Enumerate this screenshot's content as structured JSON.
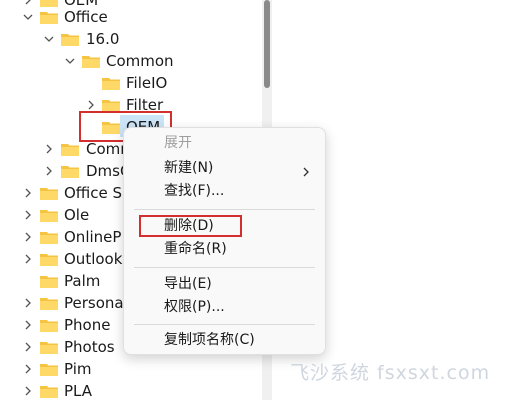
{
  "tree": {
    "items": [
      {
        "label": "OEM",
        "expanded": false
      },
      {
        "label": "Office",
        "expanded": true
      },
      {
        "label": "16.0",
        "expanded": true
      },
      {
        "label": "Common",
        "expanded": true
      },
      {
        "label": "FileIO",
        "expanded": false
      },
      {
        "label": "Filter",
        "expanded": false
      },
      {
        "label": "OEM",
        "expanded": false,
        "selected": true
      },
      {
        "label": "Comm",
        "expanded": false
      },
      {
        "label": "DmsC",
        "expanded": false
      },
      {
        "label": "Office S",
        "expanded": false
      },
      {
        "label": "Ole",
        "expanded": false
      },
      {
        "label": "OnlineP",
        "expanded": false
      },
      {
        "label": "Outlook",
        "expanded": false
      },
      {
        "label": "Palm",
        "expanded": false
      },
      {
        "label": "Persona",
        "expanded": false
      },
      {
        "label": "Phone",
        "expanded": false
      },
      {
        "label": "Photos",
        "expanded": false
      },
      {
        "label": "Pim",
        "expanded": false
      },
      {
        "label": "PLA",
        "expanded": false
      }
    ]
  },
  "context_menu": {
    "header": "展开",
    "new": "新建(N)",
    "find": "查找(F)...",
    "delete": "删除(D)",
    "rename": "重命名(R)",
    "export": "导出(E)",
    "permissions": "权限(P)...",
    "copy_key_name": "复制项名称(C)"
  },
  "watermark": "飞沙系统 fsxsxt.com",
  "colors": {
    "folder": "#f6c443",
    "highlight": "#d32f2f",
    "selection": "#cce4f7"
  }
}
